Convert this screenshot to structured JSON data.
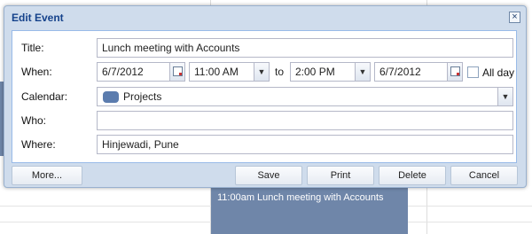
{
  "dialog": {
    "title": "Edit Event",
    "close_icon": "close-icon"
  },
  "form": {
    "title_label": "Title:",
    "title_value": "Lunch meeting with Accounts",
    "when_label": "When:",
    "start_date": "6/7/2012",
    "start_time": "11:00 AM",
    "to_text": "to",
    "end_time": "2:00 PM",
    "end_date": "6/7/2012",
    "all_day_label": "All day",
    "all_day_checked": false,
    "calendar_label": "Calendar:",
    "calendar_value": "Projects",
    "calendar_color": "#5b7cae",
    "who_label": "Who:",
    "who_value": "",
    "where_label": "Where:",
    "where_value": "Hinjewadi, Pune"
  },
  "buttons": {
    "more": "More...",
    "save": "Save",
    "print": "Print",
    "delete": "Delete",
    "cancel": "Cancel"
  },
  "background": {
    "event_text": "11:00am Lunch meeting with Accounts",
    "event_color": "#6f86a9"
  }
}
